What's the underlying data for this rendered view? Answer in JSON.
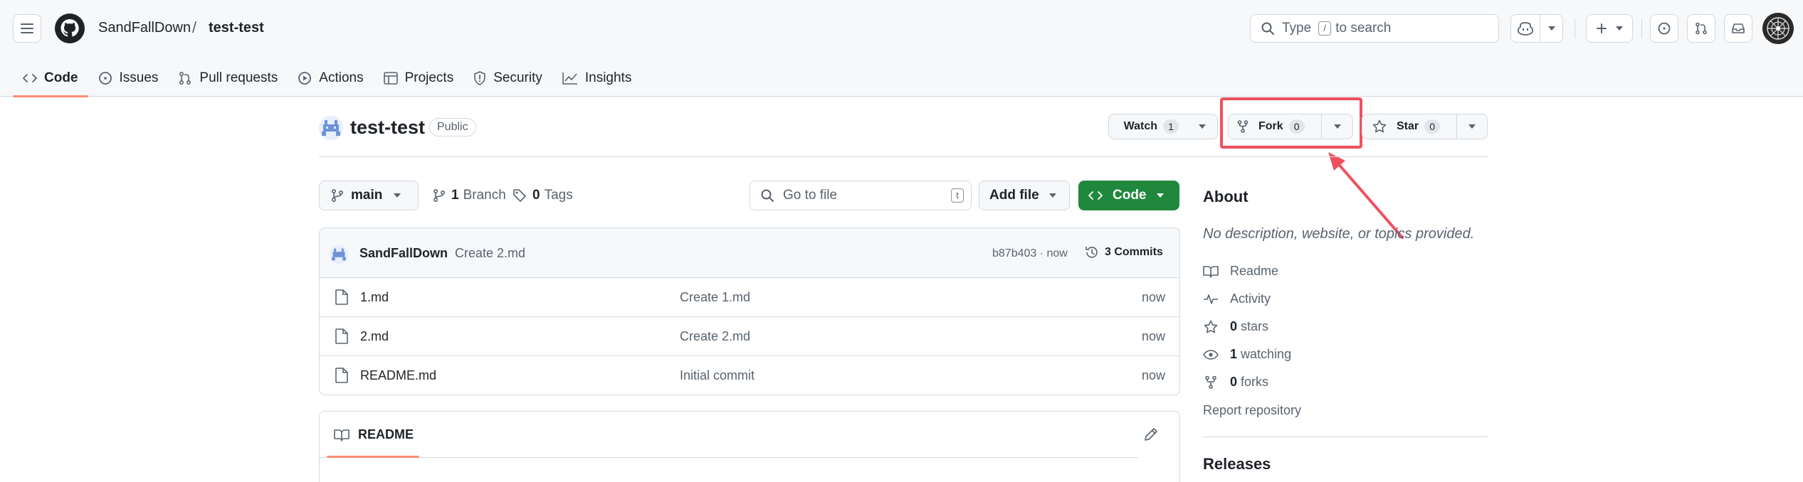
{
  "header": {
    "owner": "SandFallDown",
    "separator": "/",
    "repo": "test-test",
    "search_placeholder_prefix": "Type",
    "search_key": "/",
    "search_placeholder_suffix": "to search"
  },
  "tabs": [
    {
      "label": "Code",
      "icon": "code-icon",
      "active": true
    },
    {
      "label": "Issues",
      "icon": "issue-icon"
    },
    {
      "label": "Pull requests",
      "icon": "pull-request-icon"
    },
    {
      "label": "Actions",
      "icon": "play-icon"
    },
    {
      "label": "Projects",
      "icon": "table-icon"
    },
    {
      "label": "Security",
      "icon": "shield-icon"
    },
    {
      "label": "Insights",
      "icon": "graph-icon"
    }
  ],
  "repo": {
    "title": "test-test",
    "visibility": "Public",
    "watch_label": "Watch",
    "watch_count": "1",
    "fork_label": "Fork",
    "fork_count": "0",
    "star_label": "Star",
    "star_count": "0"
  },
  "toolbar": {
    "branch": "main",
    "branches_count": "1",
    "branches_label": "Branch",
    "tags_count": "0",
    "tags_label": "Tags",
    "goto_placeholder": "Go to file",
    "goto_key": "t",
    "add_file": "Add file",
    "code": "Code"
  },
  "commit": {
    "author": "SandFallDown",
    "message": "Create 2.md",
    "sha_time": "b87b403 · now",
    "commits_label": "3 Commits"
  },
  "files": [
    {
      "name": "1.md",
      "commit": "Create 1.md",
      "time": "now"
    },
    {
      "name": "2.md",
      "commit": "Create 2.md",
      "time": "now"
    },
    {
      "name": "README.md",
      "commit": "Initial commit",
      "time": "now"
    }
  ],
  "readme": {
    "tab_label": "README"
  },
  "about": {
    "title": "About",
    "description": "No description, website, or topics provided.",
    "readme": "Readme",
    "activity": "Activity",
    "stars_count": "0",
    "stars_label": "stars",
    "watching_count": "1",
    "watching_label": "watching",
    "forks_count": "0",
    "forks_label": "forks",
    "report": "Report repository",
    "releases": "Releases"
  },
  "colors": {
    "accent_underline": "#fd8c73",
    "code_button": "#1f883d",
    "highlight": "#f0505e"
  }
}
